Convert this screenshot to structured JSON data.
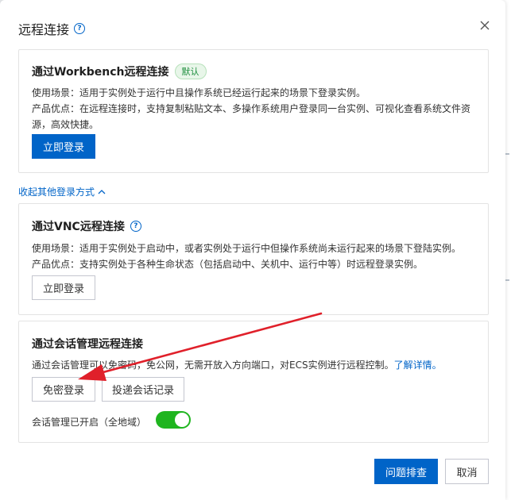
{
  "dialog": {
    "title": "远程连接",
    "help_icon": "?"
  },
  "workbench": {
    "title": "通过Workbench远程连接",
    "badge": "默认",
    "usage": "使用场景：适用于实例处于运行中且操作系统已经运行起来的场景下登录实例。",
    "advantage_line1": "产品优点：在远程连接时，支持复制粘贴文本、多操作系统用户登录同一台实例、可视化查看系统文件资",
    "advantage_line2": "源，高效快捷。",
    "login_button": "立即登录"
  },
  "toggle_link": {
    "label": "收起其他登录方式",
    "icon": "chevron-up-icon"
  },
  "vnc": {
    "title": "通过VNC远程连接",
    "help_icon": "?",
    "usage": "使用场景：适用于实例处于启动中，或者实例处于运行中但操作系统尚未运行起来的场景下登陆实例。",
    "advantage": "产品优点：支持实例处于各种生命状态（包括启动中、关机中、运行中等）时远程登录实例。",
    "login_button": "立即登录"
  },
  "session": {
    "title": "通过会话管理远程连接",
    "desc_text": "通过会话管理可以免密码，免公网，无需开放入方向端口，对ECS实例进行远程控制。",
    "desc_link": "了解详情。",
    "passwordless_button": "免密登录",
    "record_button": "投递会话记录",
    "switch_label": "会话管理已开启（全地域）",
    "switch_on": true
  },
  "footer": {
    "troubleshoot_button": "问题排查",
    "cancel_button": "取消"
  },
  "colors": {
    "primary": "#0064c8",
    "switch_on": "#1fb51f",
    "annotation_arrow": "#e0202a"
  }
}
